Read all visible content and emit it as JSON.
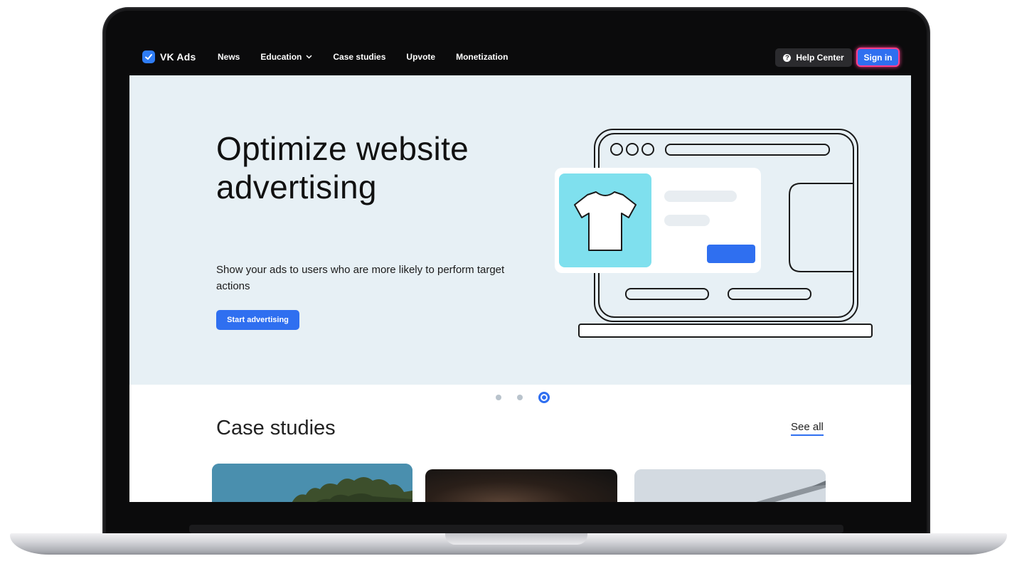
{
  "nav": {
    "logo_text": "VK Ads",
    "links": [
      {
        "label": "News"
      },
      {
        "label": "Education"
      },
      {
        "label": "Case studies"
      },
      {
        "label": "Upvote"
      },
      {
        "label": "Monetization"
      }
    ],
    "help_label": "Help Center",
    "signin_label": "Sign in"
  },
  "hero": {
    "title": "Optimize website advertising",
    "subtitle": "Show your ads to users who are more likely to perform target actions",
    "cta_label": "Start advertising",
    "carousel": {
      "slide_count": 3,
      "active_index": 3
    }
  },
  "case_studies": {
    "title": "Case studies",
    "see_all_label": "See all"
  },
  "colors": {
    "accent": "#2f6ff0",
    "nav_bg": "#0b0b0c",
    "hero_bg": "#e7f0f5",
    "highlight": "#ff3d8b",
    "tshirt_tile": "#7fe0ee"
  }
}
